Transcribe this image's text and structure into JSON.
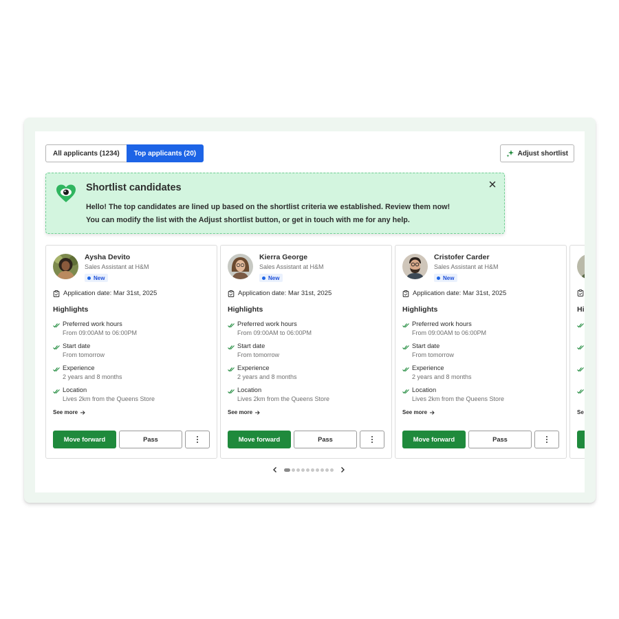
{
  "tabs": {
    "all": "All applicants (1234)",
    "top": "Top applicants (20)"
  },
  "adjust_button": "Adjust shortlist",
  "banner": {
    "title": "Shortlist candidates",
    "line1": "Hello! The top candidates are lined up based on the shortlist criteria we established. Review them now!",
    "line2": "You can modify the list with the Adjust shortlist button, or get in touch with me for any help."
  },
  "cards": [
    {
      "name": "Aysha Devito",
      "role": "Sales Assistant at H&M",
      "badge": "New",
      "date": "Application date: Mar 31st, 2025",
      "highlights_title": "Highlights",
      "highlights": [
        {
          "label": "Preferred work hours",
          "value": "From 09:00AM to 06:00PM"
        },
        {
          "label": "Start date",
          "value": "From tomorrow"
        },
        {
          "label": "Experience",
          "value": "2 years and 8 months"
        },
        {
          "label": "Location",
          "value": "Lives 2km from the Queens Store"
        }
      ],
      "see_more": "See more",
      "move_forward": "Move forward",
      "pass": "Pass"
    },
    {
      "name": "Kierra George",
      "role": "Sales Assistant at H&M",
      "badge": "New",
      "date": "Application date: Mar 31st, 2025",
      "highlights_title": "Highlights",
      "highlights": [
        {
          "label": "Preferred work hours",
          "value": "From 09:00AM to 06:00PM"
        },
        {
          "label": "Start date",
          "value": "From tomorrow"
        },
        {
          "label": "Experience",
          "value": "2 years and 8 months"
        },
        {
          "label": "Location",
          "value": "Lives 2km from the Queens Store"
        }
      ],
      "see_more": "See more",
      "move_forward": "Move forward",
      "pass": "Pass"
    },
    {
      "name": "Cristofer Carder",
      "role": "Sales Assistant at H&M",
      "badge": "New",
      "date": "Application date: Mar 31st, 2025",
      "highlights_title": "Highlights",
      "highlights": [
        {
          "label": "Preferred work hours",
          "value": "From 09:00AM to 06:00PM"
        },
        {
          "label": "Start date",
          "value": "From tomorrow"
        },
        {
          "label": "Experience",
          "value": "2 years and 8 months"
        },
        {
          "label": "Location",
          "value": "Lives 2km from the Queens Store"
        }
      ],
      "see_more": "See more",
      "move_forward": "Move forward",
      "pass": "Pass"
    }
  ],
  "partial_card": {
    "highlights_prefix": "Hi",
    "see_more_prefix": "Se"
  },
  "pagination": {
    "current": 1,
    "total": 10
  },
  "colors": {
    "primary_blue": "#1d64e6",
    "success_green": "#1f8a3c",
    "banner_bg": "#d3f5df",
    "frame_bg": "#eef6f0"
  }
}
